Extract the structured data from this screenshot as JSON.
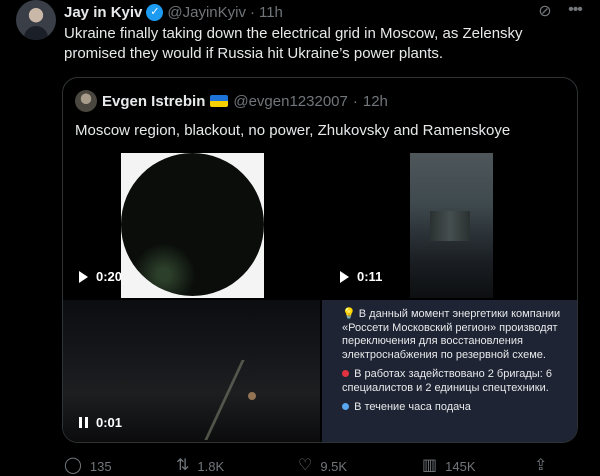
{
  "tweet": {
    "display_name": "Jay in Kyiv",
    "handle": "@JayinKyiv",
    "separator": "·",
    "time": "11h",
    "text": "Ukraine finally taking down the electrical grid in Moscow, as Zelensky promised they would if Russia hit Ukraine’s power plants."
  },
  "quote": {
    "display_name": "Evgen Istrebin",
    "handle": "@evgen1232007",
    "separator": "·",
    "time": "12h",
    "text": "Moscow region, blackout, no power, Zhukovsky and Ramenskoye",
    "media": [
      {
        "duration": "0:20",
        "state": "play"
      },
      {
        "duration": "0:11",
        "state": "play"
      },
      {
        "duration": "0:01",
        "state": "pause"
      }
    ],
    "ru_post": {
      "p1": "В данный момент энергетики компании «Россети Московский регион» производят переключения для восстановления электроснабжения по резервной схеме.",
      "p2": "В работах задействовано 2 бригады: 6 специалистов и 2 единицы спецтехники.",
      "p3": "В течение часа подача"
    }
  },
  "actions": {
    "replies": "135",
    "reposts": "1.8K",
    "likes": "9.5K",
    "views": "145K"
  },
  "colors": {
    "background": "#000000",
    "text": "#e7e9ea",
    "muted": "#71767b",
    "verified": "#1d9bf0",
    "border": "#2f3336"
  }
}
